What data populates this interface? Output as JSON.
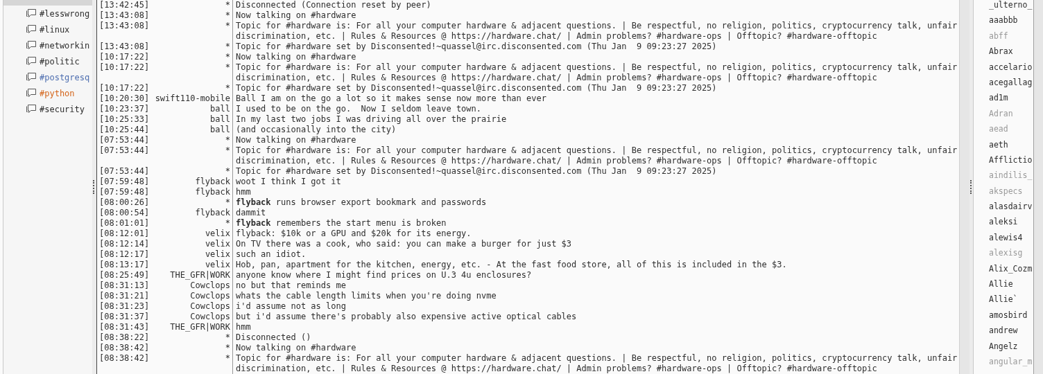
{
  "channels": [
    {
      "name": "#lesswrong",
      "color": "#2e2e2e"
    },
    {
      "name": "#linux",
      "color": "#2e2e2e"
    },
    {
      "name": "#networkin",
      "color": "#2e2e2e"
    },
    {
      "name": "#politic",
      "color": "#2e2e2e"
    },
    {
      "name": "#postgresq",
      "color": "#4f6fb0"
    },
    {
      "name": "#python",
      "color": "#d4661c"
    },
    {
      "name": "#security",
      "color": "#2e2e2e"
    }
  ],
  "messages": [
    {
      "time": "[13:42:45]",
      "nick": "*",
      "text": "Disconnected (Connection reset by peer)"
    },
    {
      "time": "[13:43:08]",
      "nick": "*",
      "text": "Now talking on #hardware"
    },
    {
      "time": "[13:43:08]",
      "nick": "*",
      "text": "Topic for #hardware is: For all your computer hardware & adjacent questions. | Be respectful, no religion, politics, cryptocurrency talk, unfair discrimination, etc. | Rules & Resources @ https://hardware.chat/ | Admin problems? #hardware-ops | Offtopic? #hardware-offtopic"
    },
    {
      "time": "[13:43:08]",
      "nick": "*",
      "text": "Topic for #hardware set by Disconsented!~quassel@irc.disconsented.com (Thu Jan  9 09:23:27 2025)"
    },
    {
      "time": "[10:17:22]",
      "nick": "*",
      "text": "Now talking on #hardware"
    },
    {
      "time": "[10:17:22]",
      "nick": "*",
      "text": "Topic for #hardware is: For all your computer hardware & adjacent questions. | Be respectful, no religion, politics, cryptocurrency talk, unfair discrimination, etc. | Rules & Resources @ https://hardware.chat/ | Admin problems? #hardware-ops | Offtopic? #hardware-offtopic"
    },
    {
      "time": "[10:17:22]",
      "nick": "*",
      "text": "Topic for #hardware set by Disconsented!~quassel@irc.disconsented.com (Thu Jan  9 09:23:27 2025)"
    },
    {
      "time": "[10:20:30]",
      "nick": "swift110-mobile",
      "text": "Ball I am on the go a lot so it makes sense now more than ever"
    },
    {
      "time": "[10:23:37]",
      "nick": "ball",
      "text": "I used to be on the go.  Now I seldom leave town."
    },
    {
      "time": "[10:25:33]",
      "nick": "ball",
      "text": "In my last two jobs I was driving all over the prairie"
    },
    {
      "time": "[10:25:44]",
      "nick": "ball",
      "text": "(and occasionally into the city)"
    },
    {
      "time": "[07:53:44]",
      "nick": "*",
      "text": "Now talking on #hardware"
    },
    {
      "time": "[07:53:44]",
      "nick": "*",
      "text": "Topic for #hardware is: For all your computer hardware & adjacent questions. | Be respectful, no religion, politics, cryptocurrency talk, unfair discrimination, etc. | Rules & Resources @ https://hardware.chat/ | Admin problems? #hardware-ops | Offtopic? #hardware-offtopic"
    },
    {
      "time": "[07:53:44]",
      "nick": "*",
      "text": "Topic for #hardware set by Disconsented!~quassel@irc.disconsented.com (Thu Jan  9 09:23:27 2025)"
    },
    {
      "time": "[07:59:48]",
      "nick": "flyback",
      "text": "woot I think I got it"
    },
    {
      "time": "[07:59:48]",
      "nick": "flyback",
      "text": "hmm"
    },
    {
      "time": "[08:00:26]",
      "nick": "*",
      "text": "**flyback** runs browser export bookmark and passwords"
    },
    {
      "time": "[08:00:54]",
      "nick": "flyback",
      "text": "dammit"
    },
    {
      "time": "[08:01:01]",
      "nick": "*",
      "text": "**flyback** remembers the start menu is broken"
    },
    {
      "time": "[08:12:01]",
      "nick": "velix",
      "text": "flyback: $10k or a GPU and $20k for its energy."
    },
    {
      "time": "[08:12:14]",
      "nick": "velix",
      "text": "On TV there was a cook, who said: you can make a burger for just $3"
    },
    {
      "time": "[08:12:17]",
      "nick": "velix",
      "text": "such an idiot."
    },
    {
      "time": "[08:13:17]",
      "nick": "velix",
      "text": "Hob, pan, apartment for the kitchen, energy, etc. - At the fast food store, all of this is included in the $3."
    },
    {
      "time": "[08:25:49]",
      "nick": "THE_GFR|WORK",
      "text": "anyone know where I might find prices on U.3 4u enclosures?"
    },
    {
      "time": "[08:31:13]",
      "nick": "Cowclops",
      "text": "no but that reminds me"
    },
    {
      "time": "[08:31:21]",
      "nick": "Cowclops",
      "text": "whats the cable length limits when you're doing nvme"
    },
    {
      "time": "[08:31:23]",
      "nick": "Cowclops",
      "text": "i'd assume not as long"
    },
    {
      "time": "[08:31:37]",
      "nick": "Cowclops",
      "text": "but i'd assume there's probably also expensive active optical cables"
    },
    {
      "time": "[08:31:43]",
      "nick": "THE_GFR|WORK",
      "text": "hmm"
    },
    {
      "time": "[08:38:22]",
      "nick": "*",
      "text": "Disconnected ()"
    },
    {
      "time": "[08:38:42]",
      "nick": "*",
      "text": "Now talking on #hardware"
    },
    {
      "time": "[08:38:42]",
      "nick": "*",
      "text": "Topic for #hardware is: For all your computer hardware & adjacent questions. | Be respectful, no religion, politics, cryptocurrency talk, unfair discrimination, etc. | Rules & Resources @ https://hardware.chat/ | Admin problems? #hardware-ops | Offtopic? #hardware-offtopic"
    }
  ],
  "users": [
    {
      "nick": "_ulterno_",
      "away": false
    },
    {
      "nick": "aaabbb",
      "away": false
    },
    {
      "nick": "abff",
      "away": true
    },
    {
      "nick": "Abrax",
      "away": false
    },
    {
      "nick": "accelario",
      "away": false
    },
    {
      "nick": "acegallag",
      "away": false
    },
    {
      "nick": "ad1m",
      "away": false
    },
    {
      "nick": "Adran",
      "away": true
    },
    {
      "nick": "aead",
      "away": true
    },
    {
      "nick": "aeth",
      "away": false
    },
    {
      "nick": "Afflictio",
      "away": false
    },
    {
      "nick": "aindilis_",
      "away": true
    },
    {
      "nick": "akspecs",
      "away": true
    },
    {
      "nick": "alasdairv",
      "away": false
    },
    {
      "nick": "aleksi",
      "away": false
    },
    {
      "nick": "alewis4",
      "away": false
    },
    {
      "nick": "alexisg",
      "away": true
    },
    {
      "nick": "Alix_Cozm",
      "away": false
    },
    {
      "nick": "Allie",
      "away": false
    },
    {
      "nick": "Allie`",
      "away": false
    },
    {
      "nick": "amosbird",
      "away": false
    },
    {
      "nick": "andrew",
      "away": false
    },
    {
      "nick": "Angelz",
      "away": false
    },
    {
      "nick": "angular_m",
      "away": true
    }
  ]
}
